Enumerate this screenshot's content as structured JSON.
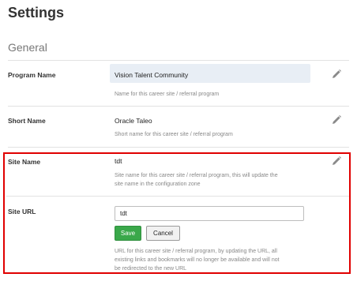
{
  "page": {
    "title": "Settings"
  },
  "section": {
    "title": "General"
  },
  "fields": {
    "program_name": {
      "label": "Program Name",
      "value": "Vision Talent Community",
      "help": "Name for this career site / referral program"
    },
    "short_name": {
      "label": "Short Name",
      "value": "Oracle Taleo",
      "help": "Short name for this career site / referral program"
    },
    "site_name": {
      "label": "Site Name",
      "value": "tdt",
      "help_line1": "Site name for this career site / referral program, this will update the",
      "help_line2": "site name in the configuration zone"
    },
    "site_url": {
      "label": "Site URL",
      "input_value": "tdt",
      "save_label": "Save",
      "cancel_label": "Cancel",
      "help_line1": "URL for this career site / referral program, by updating the URL, all",
      "help_line2": "existing links and bookmarks will no longer be available and will not",
      "help_line3": "be redirected to the new URL"
    }
  },
  "icons": {
    "edit": "pencil-icon"
  },
  "colors": {
    "highlight_border": "#e00000",
    "save_button": "#3aa84a",
    "value_highlight": "#e8eef5"
  }
}
